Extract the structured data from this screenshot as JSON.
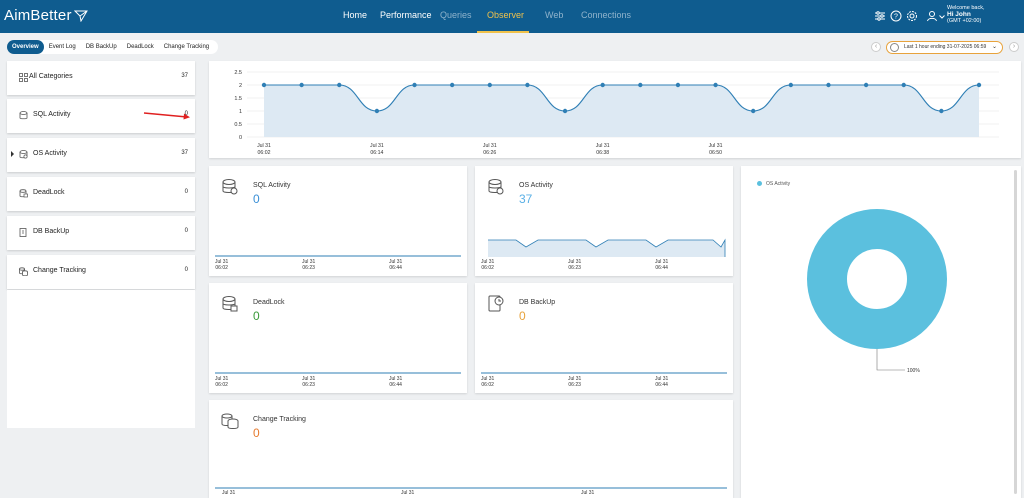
{
  "app": {
    "logo": "AimBetter"
  },
  "nav": [
    {
      "label": "Home",
      "state": "normal"
    },
    {
      "label": "Performance",
      "state": "normal"
    },
    {
      "label": "Queries",
      "state": "dim"
    },
    {
      "label": "Observer",
      "state": "active"
    },
    {
      "label": "Web",
      "state": "dim"
    },
    {
      "label": "Connections",
      "state": "dim"
    }
  ],
  "user": {
    "welcome": "Welcome back,",
    "name": "Hi John",
    "timezone": "(GMT +02:00)"
  },
  "tabs": [
    "Overview",
    "Event Log",
    "DB BackUp",
    "DeadLock",
    "Change Tracking"
  ],
  "time_range": "Last 1 hour ending  31-07-2025 06:59",
  "sidebar": [
    {
      "label": "All Categories",
      "count": "37",
      "icon": "grid-icon"
    },
    {
      "label": "SQL Activity",
      "count": "0",
      "icon": "database-icon"
    },
    {
      "label": "OS Activity",
      "count": "37",
      "icon": "server-icon"
    },
    {
      "label": "DeadLock",
      "count": "0",
      "icon": "lock-icon"
    },
    {
      "label": "DB BackUp",
      "count": "0",
      "icon": "backup-icon"
    },
    {
      "label": "Change Tracking",
      "count": "0",
      "icon": "tracking-icon"
    }
  ],
  "chart_data": [
    {
      "type": "area",
      "x": [
        "06:02",
        "06:06",
        "06:10",
        "06:14",
        "06:18",
        "06:22",
        "06:26",
        "06:30",
        "06:34",
        "06:38",
        "06:42",
        "06:46",
        "06:50",
        "06:54",
        "06:58",
        "07:02",
        "07:06",
        "07:10",
        "07:14",
        "07:18"
      ],
      "series": [
        {
          "values": [
            2,
            2,
            2,
            1,
            2,
            2,
            2,
            2,
            1,
            2,
            2,
            2,
            2,
            1,
            2,
            2,
            2,
            2,
            1,
            2
          ]
        }
      ],
      "y_ticks": [
        "2.5",
        "2",
        "1.5",
        "1",
        "0.5",
        "0"
      ],
      "ylim": [
        0,
        2.5
      ],
      "x_ticks": [
        [
          "Jul 31",
          "06:02"
        ],
        [
          "Jul 31",
          "06:14"
        ],
        [
          "Jul 31",
          "06:26"
        ],
        [
          "Jul 31",
          "06:38"
        ],
        [
          "Jul 31",
          "06:50"
        ]
      ],
      "color": "#2f7fb5",
      "grid": true
    },
    {
      "type": "pie",
      "series": [
        {
          "name": "OS Activity",
          "values": [
            100
          ]
        }
      ],
      "legend": [
        "OS Activity"
      ],
      "labels": [
        "100%"
      ],
      "color": "#5bc0de",
      "legend_placement": "top-left"
    }
  ],
  "cards": [
    {
      "title": "SQL Activity",
      "value": "0",
      "color": "#3a8fd6",
      "ticks": [
        [
          "Jul 31",
          "06:02"
        ],
        [
          "Jul 31",
          "06:23"
        ],
        [
          "Jul 31",
          "06:44"
        ]
      ]
    },
    {
      "title": "OS Activity",
      "value": "37",
      "color": "#5ab0e6",
      "ticks": [
        [
          "Jul 31",
          "06:02"
        ],
        [
          "Jul 31",
          "06:23"
        ],
        [
          "Jul 31",
          "06:44"
        ]
      ]
    },
    {
      "title": "DeadLock",
      "value": "0",
      "color": "#3a9a3a",
      "ticks": [
        [
          "Jul 31",
          "06:02"
        ],
        [
          "Jul 31",
          "06:23"
        ],
        [
          "Jul 31",
          "06:44"
        ]
      ]
    },
    {
      "title": "DB BackUp",
      "value": "0",
      "color": "#e8a33c",
      "ticks": [
        [
          "Jul 31",
          "06:02"
        ],
        [
          "Jul 31",
          "06:23"
        ],
        [
          "Jul 31",
          "06:44"
        ]
      ]
    },
    {
      "title": "Change Tracking",
      "value": "0",
      "color": "#e67a2e",
      "ticks": [
        "Jul 31",
        "Jul 31",
        "Jul 31"
      ]
    }
  ]
}
